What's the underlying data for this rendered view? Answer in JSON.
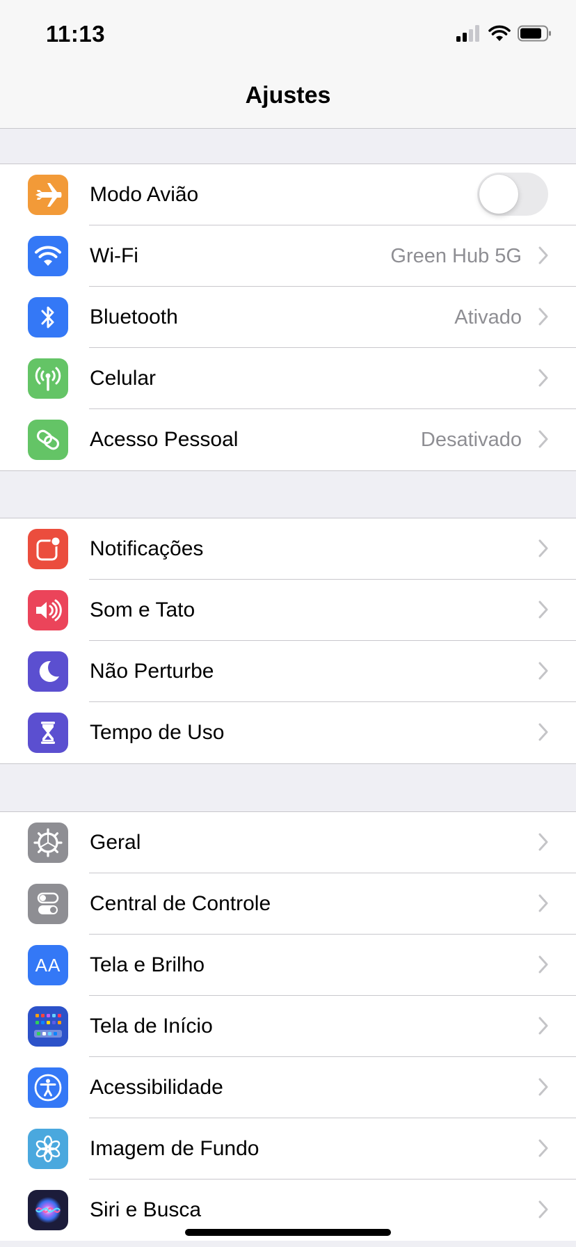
{
  "status_bar": {
    "time": "11:13"
  },
  "nav": {
    "title": "Ajustes"
  },
  "groups": [
    [
      {
        "label": "Modo Avião",
        "icon": "airplane-icon",
        "color": "#f29a38",
        "type": "toggle",
        "on": false
      },
      {
        "label": "Wi-Fi",
        "value": "Green Hub 5G",
        "icon": "wifi-icon",
        "color": "#3478f6"
      },
      {
        "label": "Bluetooth",
        "value": "Ativado",
        "icon": "bluetooth-icon",
        "color": "#3478f6"
      },
      {
        "label": "Celular",
        "icon": "antenna-icon",
        "color": "#64c466"
      },
      {
        "label": "Acesso Pessoal",
        "value": "Desativado",
        "icon": "hotspot-icon",
        "color": "#64c466"
      }
    ],
    [
      {
        "label": "Notificações",
        "icon": "notifications-icon",
        "color": "#eb4d3d"
      },
      {
        "label": "Som e Tato",
        "icon": "speaker-icon",
        "color": "#eb445a"
      },
      {
        "label": "Não Perturbe",
        "icon": "moon-icon",
        "color": "#5b4fd0"
      },
      {
        "label": "Tempo de Uso",
        "icon": "hourglass-icon",
        "color": "#5b4fd0"
      }
    ],
    [
      {
        "label": "Geral",
        "icon": "gear-icon",
        "color": "#8e8e93"
      },
      {
        "label": "Central de Controle",
        "icon": "switches-icon",
        "color": "#8e8e93"
      },
      {
        "label": "Tela e Brilho",
        "icon": "text-size-icon",
        "color": "#3478f6"
      },
      {
        "label": "Tela de Início",
        "icon": "home-grid-icon",
        "color": "#2c52c9"
      },
      {
        "label": "Acessibilidade",
        "icon": "accessibility-icon",
        "color": "#3478f6"
      },
      {
        "label": "Imagem de Fundo",
        "icon": "flower-icon",
        "color": "#4aa8de"
      },
      {
        "label": "Siri e Busca",
        "icon": "siri-icon",
        "color": "#1c1c3a"
      }
    ]
  ],
  "icon_text": {
    "text_size": "AA"
  }
}
